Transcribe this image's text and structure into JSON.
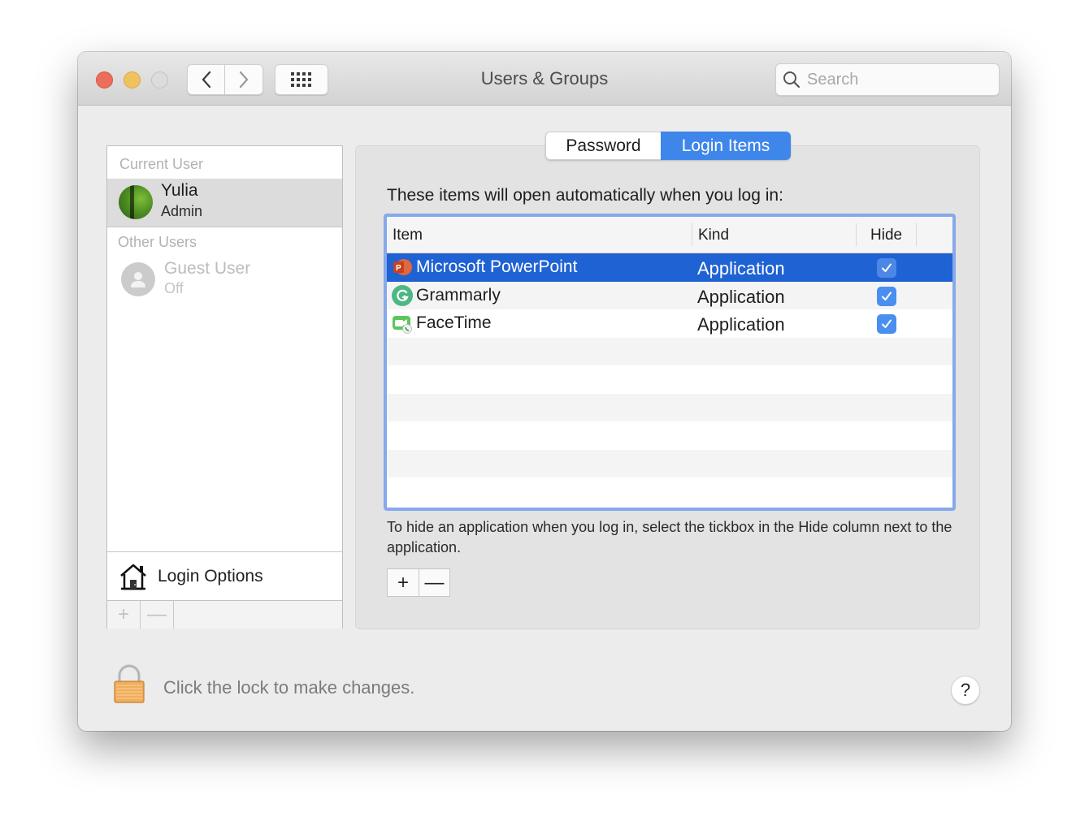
{
  "window": {
    "title": "Users & Groups",
    "search_placeholder": "Search",
    "icons": {
      "back": "chevron-left-icon",
      "forward": "chevron-right-icon",
      "show_all": "grid-icon",
      "search": "magnifier-icon"
    }
  },
  "sidebar": {
    "current_user_label": "Current User",
    "current_user": {
      "name": "Yulia",
      "role": "Admin"
    },
    "other_users_label": "Other Users",
    "other_users": [
      {
        "name": "Guest User",
        "status": "Off"
      }
    ],
    "login_options_label": "Login Options",
    "add_label": "+",
    "remove_label": "—"
  },
  "tabs": [
    {
      "label": "Password",
      "selected": false
    },
    {
      "label": "Login Items",
      "selected": true
    }
  ],
  "login_items": {
    "intro": "These items will open automatically when you log in:",
    "columns": [
      "Item",
      "Kind",
      "Hide"
    ],
    "rows": [
      {
        "item": "Microsoft PowerPoint",
        "kind": "Application",
        "hide": true,
        "selected": true,
        "icon": "powerpoint-icon"
      },
      {
        "item": "Grammarly",
        "kind": "Application",
        "hide": true,
        "selected": false,
        "icon": "grammarly-icon"
      },
      {
        "item": "FaceTime",
        "kind": "Application",
        "hide": true,
        "selected": false,
        "icon": "facetime-icon"
      }
    ],
    "hint": "To hide an application when you log in, select the tickbox in the Hide column next to the application.",
    "add_label": "+",
    "remove_label": "—"
  },
  "footer": {
    "lock_text": "Click the lock to make changes.",
    "help_label": "?"
  },
  "colors": {
    "accent": "#3f86ea",
    "selection": "#1f62d4",
    "checkbox": "#4a8ff0",
    "close": "#ec6d5a",
    "minimize": "#f2c15f"
  }
}
